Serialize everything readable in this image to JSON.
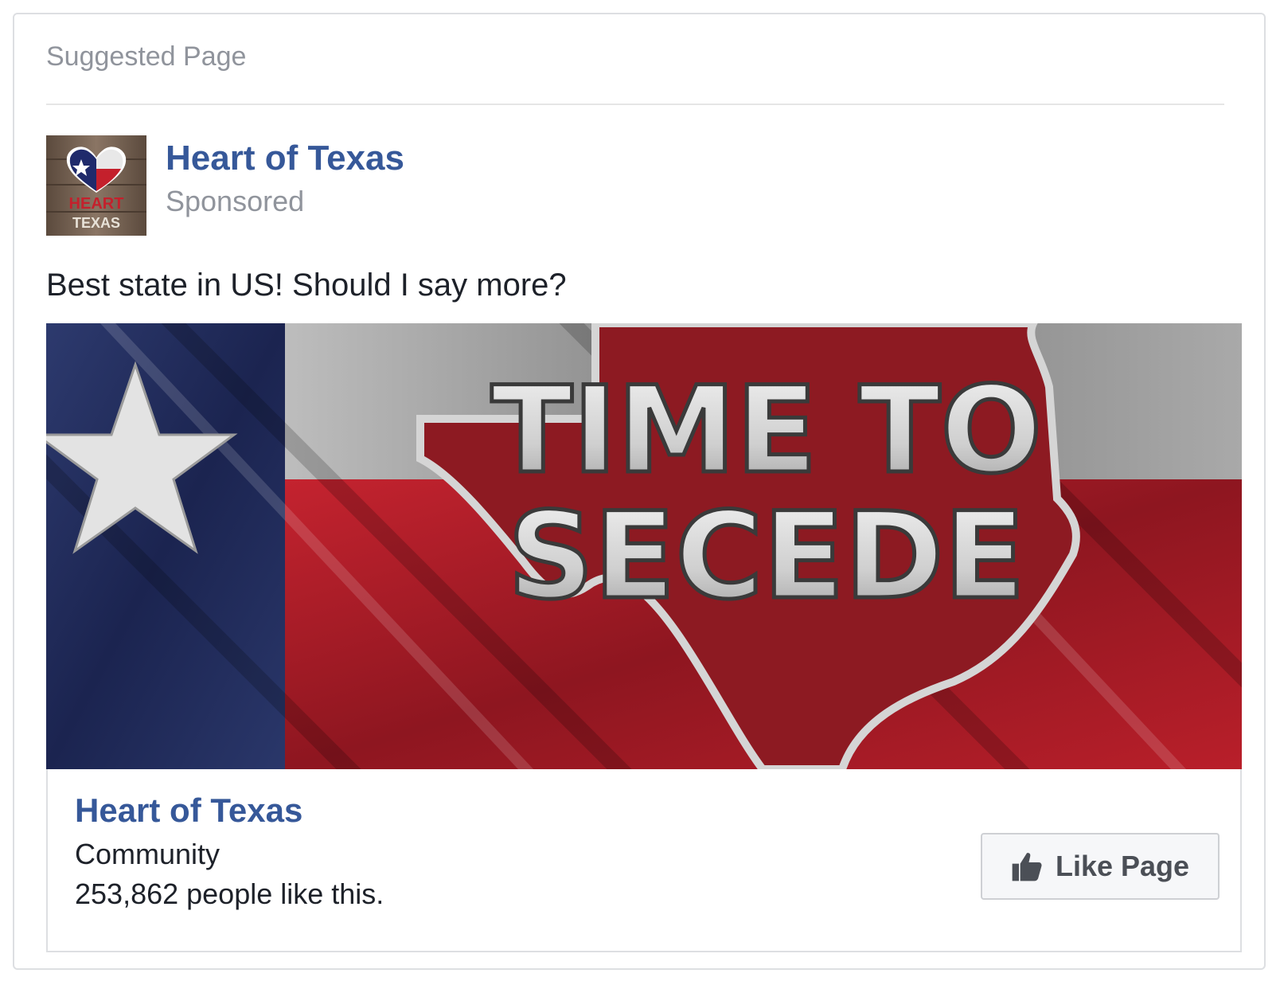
{
  "header": {
    "label": "Suggested Page"
  },
  "post": {
    "page_name": "Heart of Texas",
    "sponsored_label": "Sponsored",
    "avatar": {
      "word_top": "HEART",
      "word_bottom": "TEXAS"
    },
    "text": "Best state in US! Should I say more?"
  },
  "media": {
    "headline_line1": "TIME TO",
    "headline_line2": "SECEDE",
    "colors": {
      "blue": "#1f2a55",
      "red": "#b3202b",
      "white": "#d9d9d9"
    }
  },
  "attachment": {
    "name": "Heart of Texas",
    "category": "Community",
    "likes_text": "253,862 people like this.",
    "like_button_label": "Like Page",
    "like_icon": "thumbs-up-icon"
  },
  "colors": {
    "link": "#365899",
    "secondary_text": "#90949c",
    "border": "#dddfe2"
  }
}
